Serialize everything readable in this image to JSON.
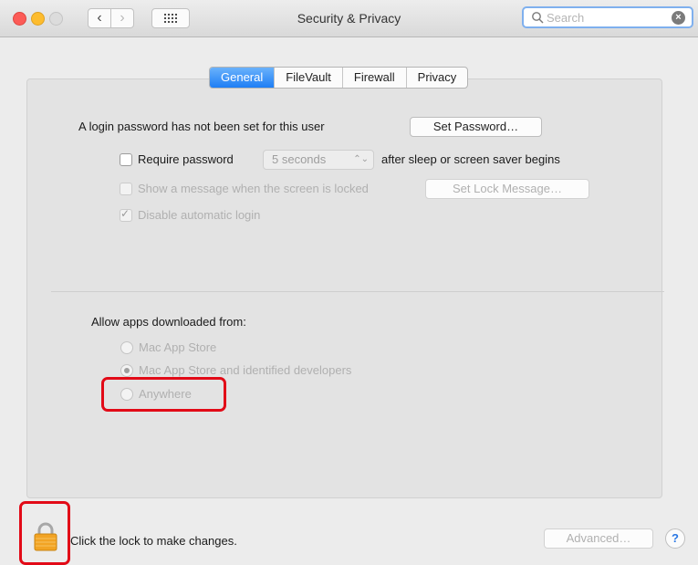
{
  "window": {
    "title": "Security & Privacy",
    "search_placeholder": "Search"
  },
  "tabs": [
    {
      "label": "General",
      "active": true
    },
    {
      "label": "FileVault",
      "active": false
    },
    {
      "label": "Firewall",
      "active": false
    },
    {
      "label": "Privacy",
      "active": false
    }
  ],
  "general": {
    "login_text": "A login password has not been set for this user",
    "set_password_label": "Set Password…",
    "require_password_label": "Require password",
    "require_password_checked": false,
    "require_password_delay": "5 seconds",
    "after_sleep_text": "after sleep or screen saver begins",
    "show_message_label": "Show a message when the screen is locked",
    "show_message_checked": false,
    "set_lock_message_label": "Set Lock Message…",
    "disable_auto_login_label": "Disable automatic login",
    "disable_auto_login_checked": true
  },
  "allow_apps": {
    "heading": "Allow apps downloaded from:",
    "options": [
      {
        "label": "Mac App Store",
        "selected": false
      },
      {
        "label": "Mac App Store and identified developers",
        "selected": true
      },
      {
        "label": "Anywhere",
        "selected": false
      }
    ]
  },
  "footer": {
    "lock_text": "Click the lock to make changes.",
    "advanced_label": "Advanced…",
    "help_label": "?"
  },
  "colors": {
    "tab_active": "#1e7ef5",
    "highlight": "#e20a17",
    "lock_body": "#f0a020"
  }
}
